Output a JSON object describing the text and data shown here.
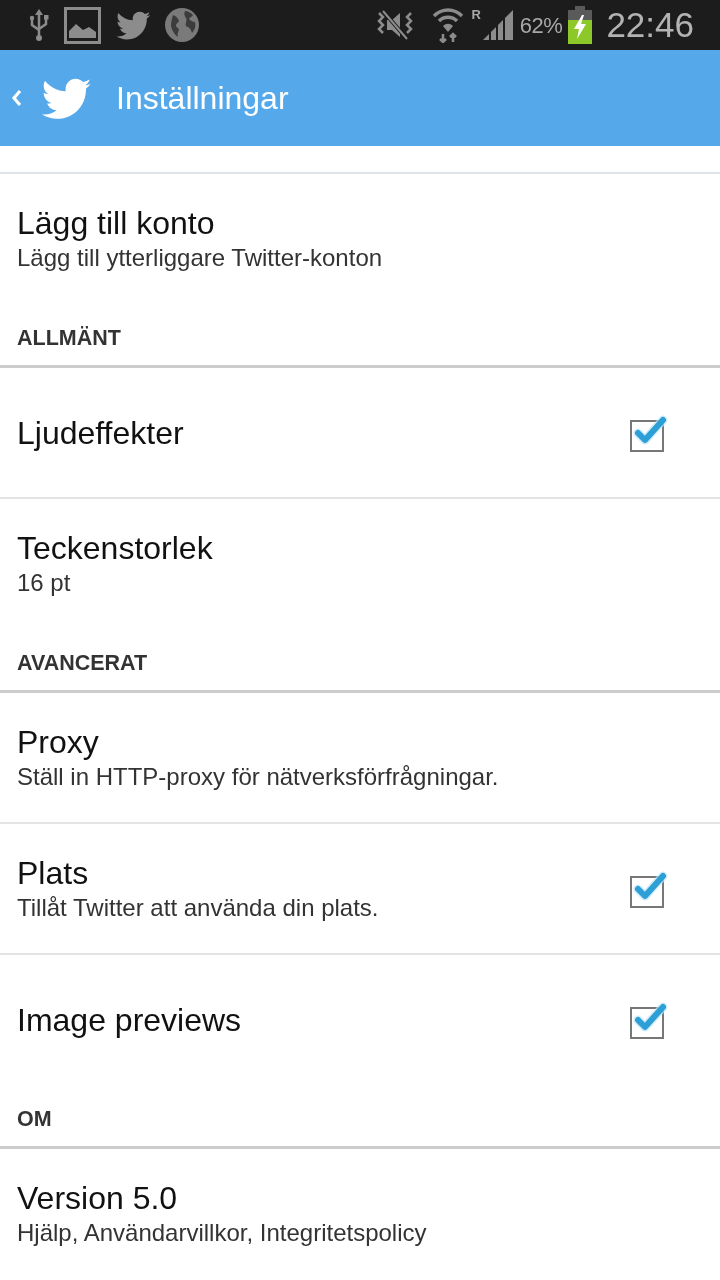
{
  "status_bar": {
    "roaming": "R",
    "battery_text": "62%",
    "time": "22:46"
  },
  "app_bar": {
    "title": "Inställningar"
  },
  "settings": [
    {
      "kind": "item",
      "title": "Lägg till konto",
      "summary": "Lägg till ytterliggare Twitter-konton"
    },
    {
      "kind": "header",
      "title": "ALLMÄNT"
    },
    {
      "kind": "checkbox",
      "title": "Ljudeffekter",
      "checked": true
    },
    {
      "kind": "item",
      "title": "Teckenstorlek",
      "summary": "16 pt"
    },
    {
      "kind": "header",
      "title": "AVANCERAT"
    },
    {
      "kind": "item",
      "title": "Proxy",
      "summary": "Ställ in HTTP-proxy för nätverksförfrågningar."
    },
    {
      "kind": "checkbox",
      "title": "Plats",
      "summary": "Tillåt Twitter att använda din plats.",
      "checked": true
    },
    {
      "kind": "checkbox",
      "title": "Image previews",
      "checked": true
    },
    {
      "kind": "header",
      "title": "OM"
    },
    {
      "kind": "item",
      "title": "Version 5.0",
      "summary": "Hjälp, Användarvillkor, Integritetspolicy"
    }
  ]
}
